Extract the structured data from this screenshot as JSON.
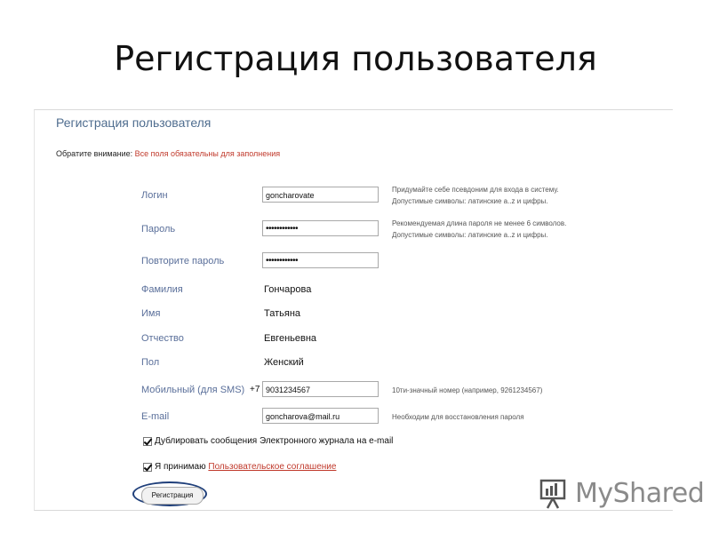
{
  "slide": {
    "title": "Регистрация пользователя"
  },
  "form": {
    "title": "Регистрация пользователя",
    "notice_prefix": "Обратите внимание:",
    "notice_text": "Все поля обязательны для заполнения",
    "fields": {
      "login": {
        "label": "Логин",
        "value": "goncharovate",
        "hint_line1": "Придумайте себе псевдоним для входа в систему.",
        "hint_line2": "Допустимые символы: латинские a..z и цифры."
      },
      "password": {
        "label": "Пароль",
        "value": "••••••••••••",
        "hint_line1": "Рекомендуемая длина пароля не менее 6 символов.",
        "hint_line2": "Допустимые символы: латинские a..z и цифры."
      },
      "password_repeat": {
        "label": "Повторите пароль",
        "value": "••••••••••••"
      },
      "surname": {
        "label": "Фамилия",
        "value": "Гончарова"
      },
      "name": {
        "label": "Имя",
        "value": "Татьяна"
      },
      "patronymic": {
        "label": "Отчество",
        "value": "Евгеньевна"
      },
      "gender": {
        "label": "Пол",
        "value": "Женский"
      },
      "mobile": {
        "label": "Мобильный (для SMS)",
        "prefix": "+7",
        "value": "9031234567",
        "hint": "10ти-значный номер (например, 9261234567)"
      },
      "email": {
        "label": "E-mail",
        "value": "goncharova@mail.ru",
        "hint": "Необходим для восстановления пароля"
      }
    },
    "checkboxes": {
      "duplicate": {
        "label": "Дублировать сообщения Электронного журнала на e-mail",
        "checked": true
      },
      "agree": {
        "label": "Я принимаю",
        "link": "Пользовательское соглашение",
        "checked": true
      }
    },
    "submit_label": "Регистрация"
  },
  "watermark": {
    "text": "MyShared"
  }
}
